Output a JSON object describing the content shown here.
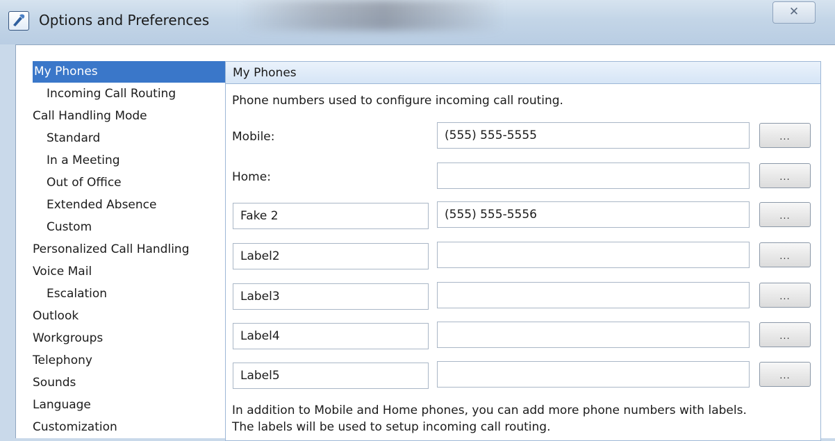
{
  "window": {
    "title": "Options and Preferences",
    "close_glyph": "✕"
  },
  "tree": {
    "items": [
      {
        "label": "My Phones",
        "level": 0,
        "selected": true
      },
      {
        "label": "Incoming Call Routing",
        "level": 1
      },
      {
        "label": "Call Handling Mode",
        "level": 0
      },
      {
        "label": "Standard",
        "level": 1
      },
      {
        "label": "In a Meeting",
        "level": 1
      },
      {
        "label": "Out of Office",
        "level": 1
      },
      {
        "label": "Extended Absence",
        "level": 1
      },
      {
        "label": "Custom",
        "level": 1
      },
      {
        "label": "Personalized Call Handling",
        "level": 0
      },
      {
        "label": "Voice Mail",
        "level": 0
      },
      {
        "label": "Escalation",
        "level": 1
      },
      {
        "label": "Outlook",
        "level": 0
      },
      {
        "label": "Workgroups",
        "level": 0
      },
      {
        "label": "Telephony",
        "level": 0
      },
      {
        "label": "Sounds",
        "level": 0
      },
      {
        "label": "Language",
        "level": 0
      },
      {
        "label": "Customization",
        "level": 0
      }
    ]
  },
  "panel": {
    "header": "My Phones",
    "description": "Phone numbers used to configure incoming call routing.",
    "rows": [
      {
        "label": "Mobile:",
        "value": "(555) 555-5555",
        "button": "..."
      },
      {
        "label": "Home:",
        "value": "",
        "button": "..."
      },
      {
        "label_input": "Fake 2",
        "value": "(555) 555-5556",
        "button": "..."
      },
      {
        "label_input": "Label2",
        "value": "",
        "button": "..."
      },
      {
        "label_input": "Label3",
        "value": "",
        "button": "..."
      },
      {
        "label_input": "Label4",
        "value": "",
        "button": "..."
      },
      {
        "label_input": "Label5",
        "value": "",
        "button": "..."
      }
    ],
    "footer_line1": "In addition to Mobile and Home phones, you can add more phone numbers with labels.",
    "footer_line2": "The labels will be used to setup incoming call routing."
  },
  "colors": {
    "selection": "#3a77c9",
    "panel_border": "#9db7d6"
  }
}
